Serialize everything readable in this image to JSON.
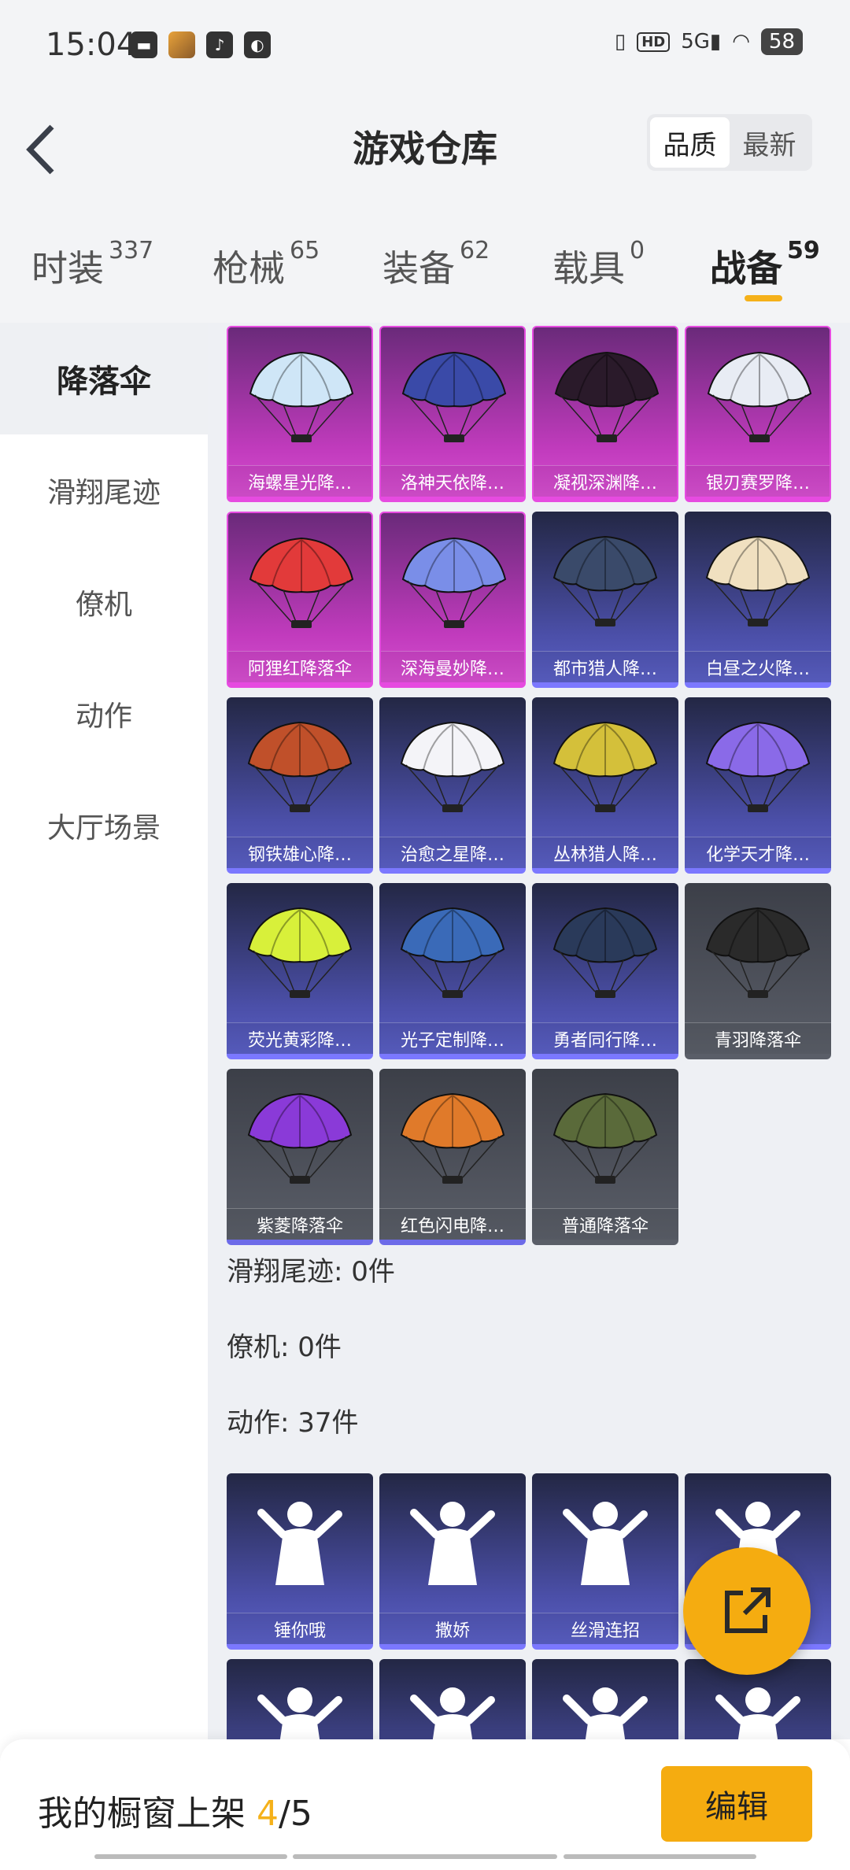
{
  "status_bar": {
    "time": "15:04",
    "network": "5G",
    "battery": "58"
  },
  "header": {
    "title": "游戏仓库",
    "sort": [
      "品质",
      "最新"
    ]
  },
  "tabs": [
    {
      "label": "时装",
      "count": "337"
    },
    {
      "label": "枪械",
      "count": "65"
    },
    {
      "label": "装备",
      "count": "62"
    },
    {
      "label": "载具",
      "count": "0"
    },
    {
      "label": "战备",
      "count": "59"
    }
  ],
  "sidebar": [
    "降落伞",
    "滑翔尾迹",
    "僚机",
    "动作",
    "大厅场景"
  ],
  "parachutes": [
    {
      "name": "海螺星光降…",
      "rarity": "purple",
      "color": "#cfe6f7"
    },
    {
      "name": "洛神天依降…",
      "rarity": "purple",
      "color": "#3a4aa8"
    },
    {
      "name": "凝视深渊降…",
      "rarity": "purple",
      "color": "#2a1a2a"
    },
    {
      "name": "银刃赛罗降…",
      "rarity": "purple",
      "color": "#e8ecf4"
    },
    {
      "name": "阿狸红降落伞",
      "rarity": "purple",
      "color": "#e23a3a"
    },
    {
      "name": "深海曼妙降…",
      "rarity": "purple",
      "color": "#7a8ee8"
    },
    {
      "name": "都市猎人降…",
      "rarity": "blue",
      "color": "#3a4a6a"
    },
    {
      "name": "白昼之火降…",
      "rarity": "blue",
      "color": "#f0e0c0"
    },
    {
      "name": "钢铁雄心降…",
      "rarity": "blue",
      "color": "#c0502a"
    },
    {
      "name": "治愈之星降…",
      "rarity": "blue",
      "color": "#f4f4f8"
    },
    {
      "name": "丛林猎人降…",
      "rarity": "blue",
      "color": "#d4c03a"
    },
    {
      "name": "化学天才降…",
      "rarity": "blue",
      "color": "#8a6ae8"
    },
    {
      "name": "荧光黄彩降…",
      "rarity": "blue",
      "color": "#d8f03a"
    },
    {
      "name": "光子定制降…",
      "rarity": "blue",
      "color": "#3a6ab8"
    },
    {
      "name": "勇者同行降…",
      "rarity": "blue",
      "color": "#2a3a5a"
    },
    {
      "name": "青羽降落伞",
      "rarity": "gray",
      "color": "#2a2a2a"
    },
    {
      "name": "紫菱降落伞",
      "rarity": "gray-b",
      "color": "#8a3ad8"
    },
    {
      "name": "红色闪电降…",
      "rarity": "gray-b",
      "color": "#e07a2a"
    },
    {
      "name": "普通降落伞",
      "rarity": "gray",
      "color": "#5a6a3a"
    }
  ],
  "sections": {
    "glide": "滑翔尾迹: 0件",
    "wingman": "僚机: 0件",
    "emotes": "动作: 37件"
  },
  "emotes": [
    {
      "name": "锤你哦"
    },
    {
      "name": "撒娇"
    },
    {
      "name": "丝滑连招"
    },
    {
      "name": ""
    },
    {
      "name": ""
    },
    {
      "name": ""
    },
    {
      "name": ""
    },
    {
      "name": ""
    }
  ],
  "bottom_bar": {
    "prefix": "我的橱窗上架 ",
    "current": "4",
    "suffix": "/5",
    "edit": "编辑"
  }
}
